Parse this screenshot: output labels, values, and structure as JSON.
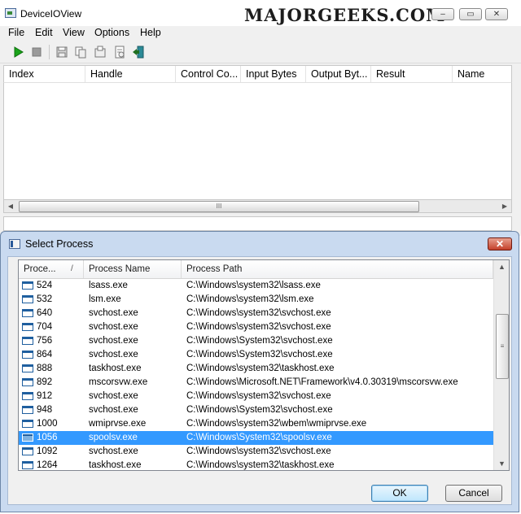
{
  "window": {
    "title": "DeviceIOView",
    "brand": "MAJORGEEKS.COM",
    "controls": {
      "minimize": "–",
      "maximize": "▭",
      "close": "✕"
    }
  },
  "menu": [
    "File",
    "Edit",
    "View",
    "Options",
    "Help"
  ],
  "toolbar": [
    "start-icon",
    "stop-icon",
    "save-icon",
    "copy-icon",
    "properties-icon",
    "html-report-icon",
    "exit-icon"
  ],
  "main_columns": [
    "Index",
    "Handle",
    "Control Co...",
    "Input Bytes",
    "Output Byt...",
    "Result",
    "Name"
  ],
  "hscroll_grip": "III",
  "dialog": {
    "title": "Select Process",
    "close": "✕",
    "columns": [
      "Proce...",
      "Process Name",
      "Process Path"
    ],
    "sort_indicator": "/",
    "rows": [
      {
        "pid": "524",
        "name": "lsass.exe",
        "path": "C:\\Windows\\system32\\lsass.exe"
      },
      {
        "pid": "532",
        "name": "lsm.exe",
        "path": "C:\\Windows\\system32\\lsm.exe"
      },
      {
        "pid": "640",
        "name": "svchost.exe",
        "path": "C:\\Windows\\system32\\svchost.exe"
      },
      {
        "pid": "704",
        "name": "svchost.exe",
        "path": "C:\\Windows\\system32\\svchost.exe"
      },
      {
        "pid": "756",
        "name": "svchost.exe",
        "path": "C:\\Windows\\System32\\svchost.exe"
      },
      {
        "pid": "864",
        "name": "svchost.exe",
        "path": "C:\\Windows\\System32\\svchost.exe"
      },
      {
        "pid": "888",
        "name": "taskhost.exe",
        "path": "C:\\Windows\\system32\\taskhost.exe"
      },
      {
        "pid": "892",
        "name": "mscorsvw.exe",
        "path": "C:\\Windows\\Microsoft.NET\\Framework\\v4.0.30319\\mscorsvw.exe"
      },
      {
        "pid": "912",
        "name": "svchost.exe",
        "path": "C:\\Windows\\system32\\svchost.exe"
      },
      {
        "pid": "948",
        "name": "svchost.exe",
        "path": "C:\\Windows\\System32\\svchost.exe"
      },
      {
        "pid": "1000",
        "name": "wmiprvse.exe",
        "path": "C:\\Windows\\system32\\wbem\\wmiprvse.exe"
      },
      {
        "pid": "1056",
        "name": "spoolsv.exe",
        "path": "C:\\Windows\\System32\\spoolsv.exe",
        "selected": true
      },
      {
        "pid": "1092",
        "name": "svchost.exe",
        "path": "C:\\Windows\\system32\\svchost.exe"
      },
      {
        "pid": "1264",
        "name": "taskhost.exe",
        "path": "C:\\Windows\\system32\\taskhost.exe"
      }
    ],
    "scroll_grip": "≡",
    "ok_label": "OK",
    "cancel_label": "Cancel"
  },
  "colors": {
    "selection": "#3399ff",
    "dialog_frame": "#c9daf0",
    "close_button": "#c4402a"
  }
}
